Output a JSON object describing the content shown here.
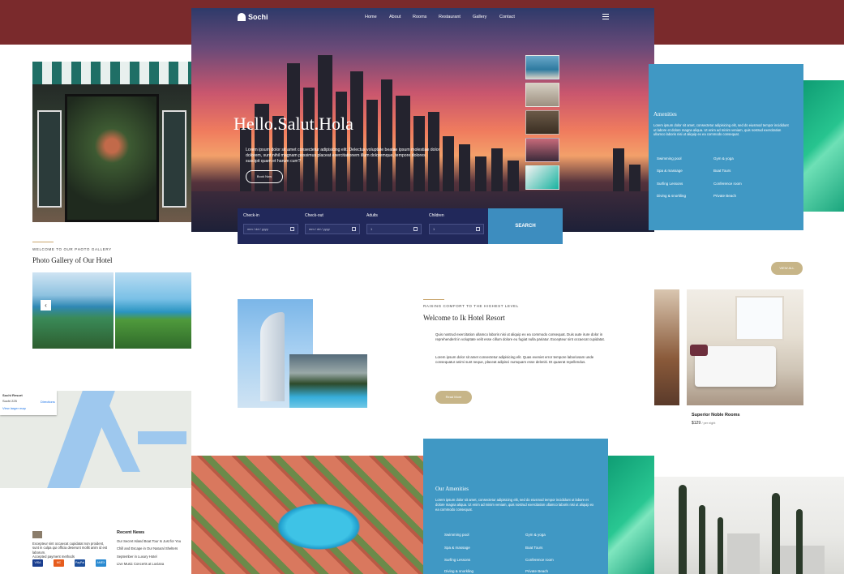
{
  "brand": {
    "name": "Sochi"
  },
  "nav": [
    "Home",
    "About",
    "Rooms",
    "Restaurant",
    "Gallery",
    "Contact"
  ],
  "hero": {
    "title": "Hello.Salut.Hola",
    "description": "Lorem ipsum dolor sit amet consectetur adipisicing elit. Delectus voluptate beatae ipsum molestiae dolor dolorem, sunt nihil magnam possimus placeat exercitationem illum doloremque, tempore dolores suscipit quam et harum cum?",
    "button": "Book Now"
  },
  "booking": {
    "fields": [
      {
        "label": "Check-in",
        "placeholder": "mm / dd / yyyy"
      },
      {
        "label": "Check-out",
        "placeholder": "mm / dd / yyyy"
      },
      {
        "label": "Adults",
        "placeholder": "1"
      },
      {
        "label": "Children",
        "placeholder": "1"
      }
    ],
    "search": "SEARCH"
  },
  "gallery": {
    "kicker": "Welcome to our photo gallery",
    "title": "Photo Gallery of Our Hotel",
    "prev": "‹"
  },
  "map_card": {
    "title": "Sochi Resort",
    "subtitle": "Sochi 225",
    "link": "View larger map",
    "directions": "Directions"
  },
  "amenities_top": {
    "title": "Amenities",
    "description": "Lorem ipsum dolor sit amet, consectetur adipisicing elit, sed do eiusmod tempor incididunt ut labore et dolore magna aliqua. Ut enim ad minim veniam, quis nostrud exercitation ullamco laboris nisi ut aliquip ex ea commodo consequat.",
    "items": [
      "Swimming pool",
      "Gym & yoga",
      "Spa & massage",
      "Boat Tours",
      "Surfing Lessons",
      "Conference room",
      "Diving & snorkling",
      "Private Beach"
    ]
  },
  "rooms": {
    "view_all": "VIEW ALL",
    "featured": {
      "name": "Superior Noble Rooms",
      "price": "$129",
      "unit": "/ per night"
    }
  },
  "welcome": {
    "kicker": "Raising comfort to the highest level",
    "title": "Welcome to Ik Hotel Resort",
    "p1": "Quis nostrud exercitation ullamco laboris nisi ut aliquip ex ea commodo consequat. Duis aute irure dolor in reprehenderit in voluptate velit esse cillum dolore eu fugiat nulla pariatur. Excepteur sint occaecat cupidatat.",
    "p2": "Lorem ipsum dolor sit amet consectetur adipisicing elit. Quas eveniet error tempore laboriosam unde consequatur animi sunt neque, placeat adipisci numquam esse deleniti. Et quaerat repellendus.",
    "button": "Read More"
  },
  "amenities_bottom": {
    "title": "Our Amenities",
    "description": "Lorem ipsum dolor sit amet, consectetur adipisicing elit, sed do eiusmod tempor incididunt ut labore et dolore magna aliqua. Ut enim ad minim veniam, quis nostrud exercitation ullamco laboris nisi ut aliquip ex ea commodo consequat.",
    "items": [
      "Swimming pool",
      "Gym & yoga",
      "Spa & massage",
      "Boat Tours",
      "Surfing Lessons",
      "Conference room",
      "Diving & snorkling",
      "Private Beach"
    ]
  },
  "footer": {
    "about": "Excepteur sint occaecat cupidatat non proident, sunt in culpa qui officia deserunt mollit anim id est laborum.",
    "payments_label": "Accepted payment methods",
    "payments": [
      "VISA",
      "MC",
      "PayPal",
      "AMEX"
    ],
    "news_title": "Recent News",
    "news": [
      "Our Secret Island Boat Tour Is Just for You",
      "Chill and Escape in Our Natural Shelters",
      "September in Luxury Hotel",
      "Live Music Concerts at Luviana"
    ]
  },
  "colors": {
    "top_band": "#7a2a2c",
    "accent_blue": "#4098c4",
    "gold": "#c7b588",
    "booking_bg": "#21285a"
  }
}
